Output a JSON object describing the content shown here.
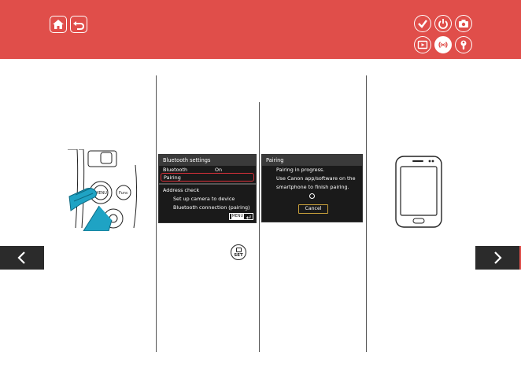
{
  "colors": {
    "header_bg": "#e04e4a",
    "nav_bg": "#2b2b2b",
    "screen_bg": "#1a1a1a",
    "selection": "#d8303a",
    "accent_cancel": "#c9a13b"
  },
  "header": {
    "left_icons": [
      "home-icon",
      "back-icon"
    ],
    "category_icons": [
      "check-icon",
      "power-icon",
      "camera-icon",
      "playback-icon",
      "wireless-icon",
      "wrench-icon"
    ],
    "active_category": "wireless-icon"
  },
  "camera_screen_1": {
    "title": "Bluetooth settings",
    "rows": [
      {
        "label": "Bluetooth",
        "value": "On"
      },
      {
        "label": "Pairing",
        "value": ""
      },
      {
        "label": "Address check",
        "value": ""
      }
    ],
    "sub_rows": [
      "Set up camera to device",
      "Bluetooth connection (pairing)"
    ],
    "menu_badge": "MENU"
  },
  "camera_screen_2": {
    "title": "Pairing",
    "lines": [
      "Pairing in progress.",
      "Use Canon app/software on the",
      "smartphone to finish pairing."
    ],
    "cancel_label": "Cancel"
  },
  "set_button_label": "SET",
  "camera_menu_label": "MENU",
  "camera_func_label": "Func"
}
